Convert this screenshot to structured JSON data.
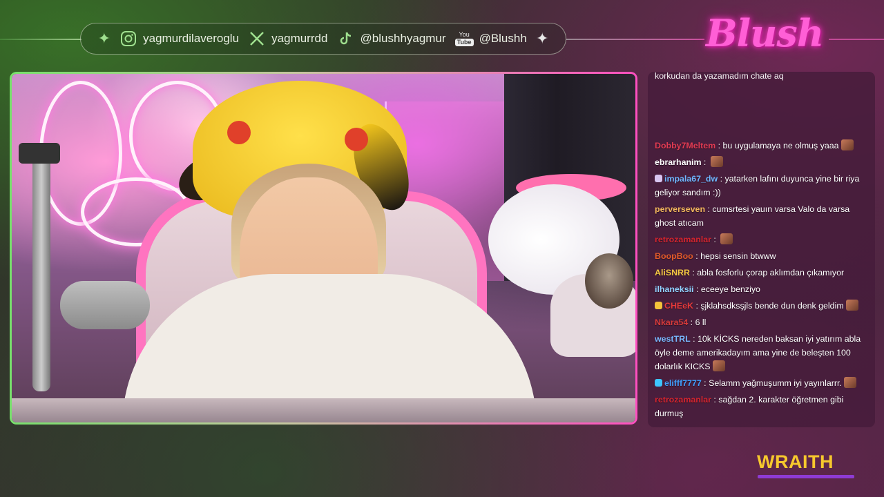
{
  "social": {
    "instagram": "yagmurdilaveroglu",
    "x": "yagmurrdd",
    "tiktok": "@blushhyagmur",
    "youtube": "@Blushh",
    "youtube_icon_top": "You",
    "youtube_icon_bottom": "Tube"
  },
  "logo": {
    "text": "Blush"
  },
  "sponsor": {
    "text": "WRAITH"
  },
  "chat": {
    "partial_top": "korkudan da yazamadım chate aq",
    "messages": [
      {
        "user": "Dobby7Meltem",
        "color": "#e23b52",
        "badge": "",
        "text": "bu uygulamaya ne olmuş yaaa",
        "emote_after": true
      },
      {
        "user": "ebrarhanim",
        "color": "#ffffff",
        "badge": "",
        "text": "",
        "emote_after": true
      },
      {
        "user": "impala67_dw",
        "color": "#6fb6ff",
        "badge": "#d8c5f0",
        "text": "yatarken lafını duyunca yine bir riya geliyor sandım :))",
        "emote_after": false
      },
      {
        "user": "perverseven",
        "color": "#f2b75c",
        "badge": "",
        "text": "cumsrtesi yauın varsa Valo da varsa ghost atıcam",
        "emote_after": false
      },
      {
        "user": "retrozamanlar",
        "color": "#d4242e",
        "badge": "",
        "text": "",
        "emote_after": true
      },
      {
        "user": "BoopBoo",
        "color": "#e25a2a",
        "badge": "",
        "text": "hepsi sensin btwww",
        "emote_after": false
      },
      {
        "user": "AliSNRR",
        "color": "#f5c842",
        "badge": "",
        "text": "abla fosforlu çorap aklımdan çıkamıyor",
        "emote_after": false
      },
      {
        "user": "ilhaneksii",
        "color": "#8fd0ff",
        "badge": "",
        "text": "eceeye benziyo",
        "emote_after": false
      },
      {
        "user": "CHEeK",
        "color": "#e53a3a",
        "badge": "#f3c33a",
        "text": "şjklahsdksşjls bende dun denk geldim",
        "emote_after": true
      },
      {
        "user": "Nkara54",
        "color": "#d63a3a",
        "badge": "",
        "text": "6 ll",
        "emote_after": false
      },
      {
        "user": "westTRL",
        "color": "#7ab8ff",
        "badge": "",
        "text": "10k KİCKS nereden baksan iyi yatırım abla öyle deme amerikadayım ama yine de beleşten 100 dolarlık KICKS",
        "emote_after": true
      },
      {
        "user": "elifff7777",
        "color": "#3fa0ff",
        "badge": "#3dc6ff",
        "text": "Selamm yağmuşumm iyi yayınlarrr.",
        "emote_after": true
      },
      {
        "user": "retrozamanlar",
        "color": "#d4242e",
        "badge": "",
        "text": "sağdan 2. karakter öğretmen gibi durmuş",
        "emote_after": false
      }
    ]
  },
  "colors": {
    "frame_left": "#78e06c",
    "frame_right": "#ff4fc0",
    "logo_pink": "#ff5fd6",
    "sponsor_yellow": "#f7c82d",
    "sponsor_underline": "#8e3bd4"
  }
}
